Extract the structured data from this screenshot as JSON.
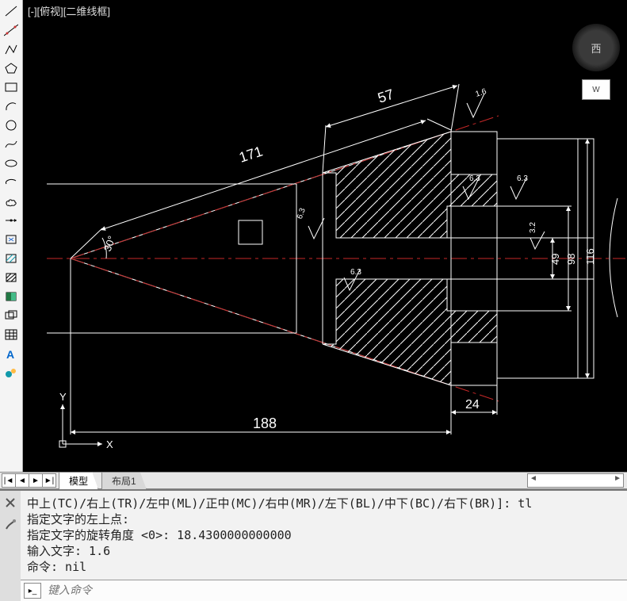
{
  "view_label": "[-][俯视][二维线框]",
  "viewcube": {
    "face": "西",
    "tool": "W"
  },
  "toolbar": {
    "tools": [
      "line",
      "construction-line",
      "polyline",
      "polygon",
      "rectangle",
      "arc",
      "circle",
      "spline",
      "ellipse",
      "ellipse-arc",
      "revcloud",
      "point",
      "block-insert",
      "hatch-pick",
      "hatch",
      "gradient",
      "region",
      "table",
      "text",
      "add-selected"
    ]
  },
  "dimensions": {
    "d171": "171",
    "d57": "57",
    "d188": "188",
    "d24": "24",
    "d49": "49",
    "d98": "98",
    "d116": "116",
    "angle30": "30°",
    "surf16": "1.6",
    "surf63a": "6.3",
    "surf63b": "6.3",
    "surf63c": "6.3",
    "surf63d": "6.3",
    "surf32": "3.2"
  },
  "tabs": {
    "nav": [
      "|◄",
      "◄",
      "►",
      "►|"
    ],
    "model": "模型",
    "layout1": "布局1"
  },
  "command": {
    "history_lines": [
      "中上(TC)/右上(TR)/左中(ML)/正中(MC)/右中(MR)/左下(BL)/中下(BC)/右下(BR)]: tl",
      "指定文字的左上点:",
      "指定文字的旋转角度 <0>: 18.4300000000000",
      "输入文字: 1.6",
      "命令: nil"
    ],
    "placeholder": "键入命令"
  },
  "colors": {
    "draw_white": "#ffffff",
    "centerline_red": "#c62828",
    "hint_blue": "#2a6ed0",
    "bg_black": "#000000"
  },
  "chart_data": {
    "type": "diagram",
    "title": "2D mechanical section (CAD)",
    "dimensions_mm": {
      "overall_length_to_vertex": 188,
      "upper_slant_length": 171,
      "top_step_length": 57,
      "right_step_width": 24,
      "bore_dia": 49,
      "outer_dia_mid": 98,
      "outer_dia_max": 116,
      "half_cone_angle_deg": 30
    },
    "surface_finish_um": {
      "cone_outer": 1.6,
      "top_step_face": 6.3,
      "right_face_outer": 6.3,
      "left_hatch_face": 6.3,
      "bore_face": 6.3,
      "inner_step": 3.2
    },
    "features": [
      "axial centerline",
      "hatched section areas (upper & lower)",
      "stepped right flange",
      "through bore"
    ]
  }
}
